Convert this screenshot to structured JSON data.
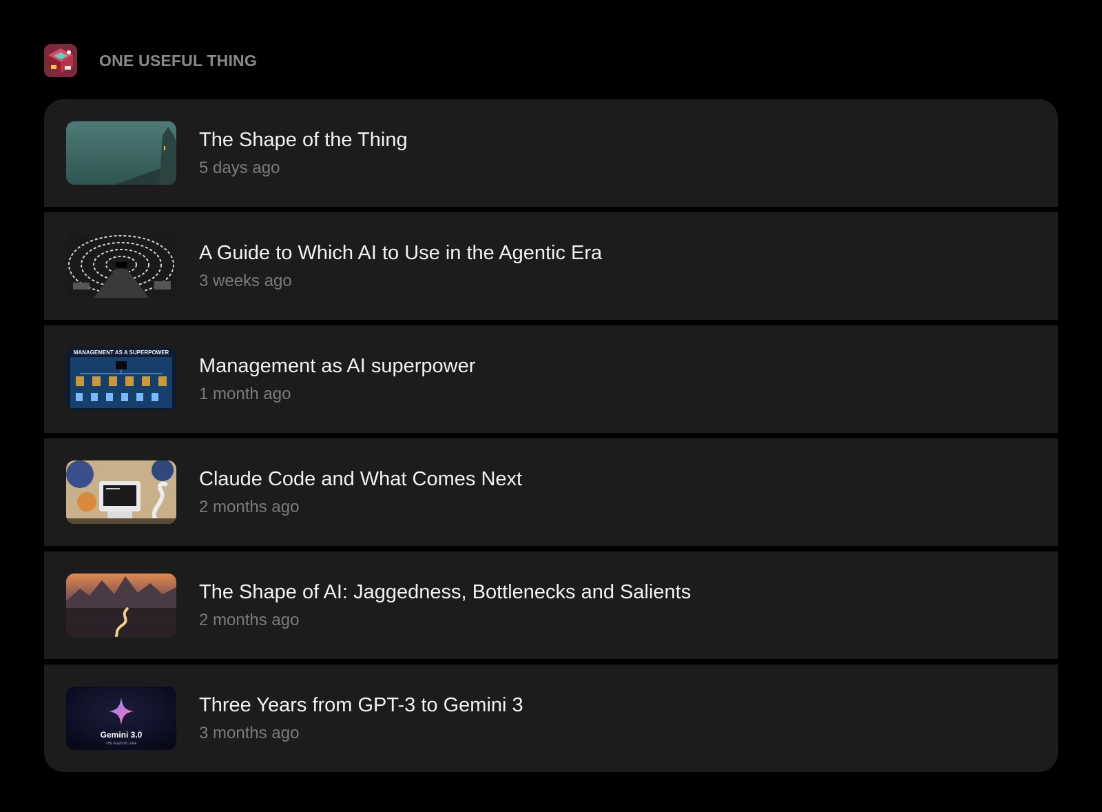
{
  "publication": {
    "name": "ONE USEFUL THING",
    "logo_icon": "isometric-desk-logo-icon"
  },
  "posts": [
    {
      "title": "The Shape of the Thing",
      "date": "5 days ago",
      "thumb_icon": "misty-castle-thumbnail"
    },
    {
      "title": "A Guide to Which AI to Use in the Agentic Era",
      "date": "3 weeks ago",
      "thumb_icon": "screen-tunnel-thumbnail"
    },
    {
      "title": "Management as AI superpower",
      "date": "1 month ago",
      "thumb_icon": "org-chart-thumbnail",
      "thumb_text": "MANAGEMENT AS A SUPERPOWER"
    },
    {
      "title": "Claude Code and What Comes Next",
      "date": "2 months ago",
      "thumb_icon": "computer-map-thumbnail"
    },
    {
      "title": "The Shape of AI: Jaggedness, Bottlenecks and Salients",
      "date": "2 months ago",
      "thumb_icon": "mountain-river-thumbnail"
    },
    {
      "title": "Three Years from GPT-3 to Gemini 3",
      "date": "3 months ago",
      "thumb_icon": "gemini-star-thumbnail",
      "thumb_text": "Gemini 3.0",
      "thumb_subtext": "THE AGENTIC ERA"
    }
  ]
}
